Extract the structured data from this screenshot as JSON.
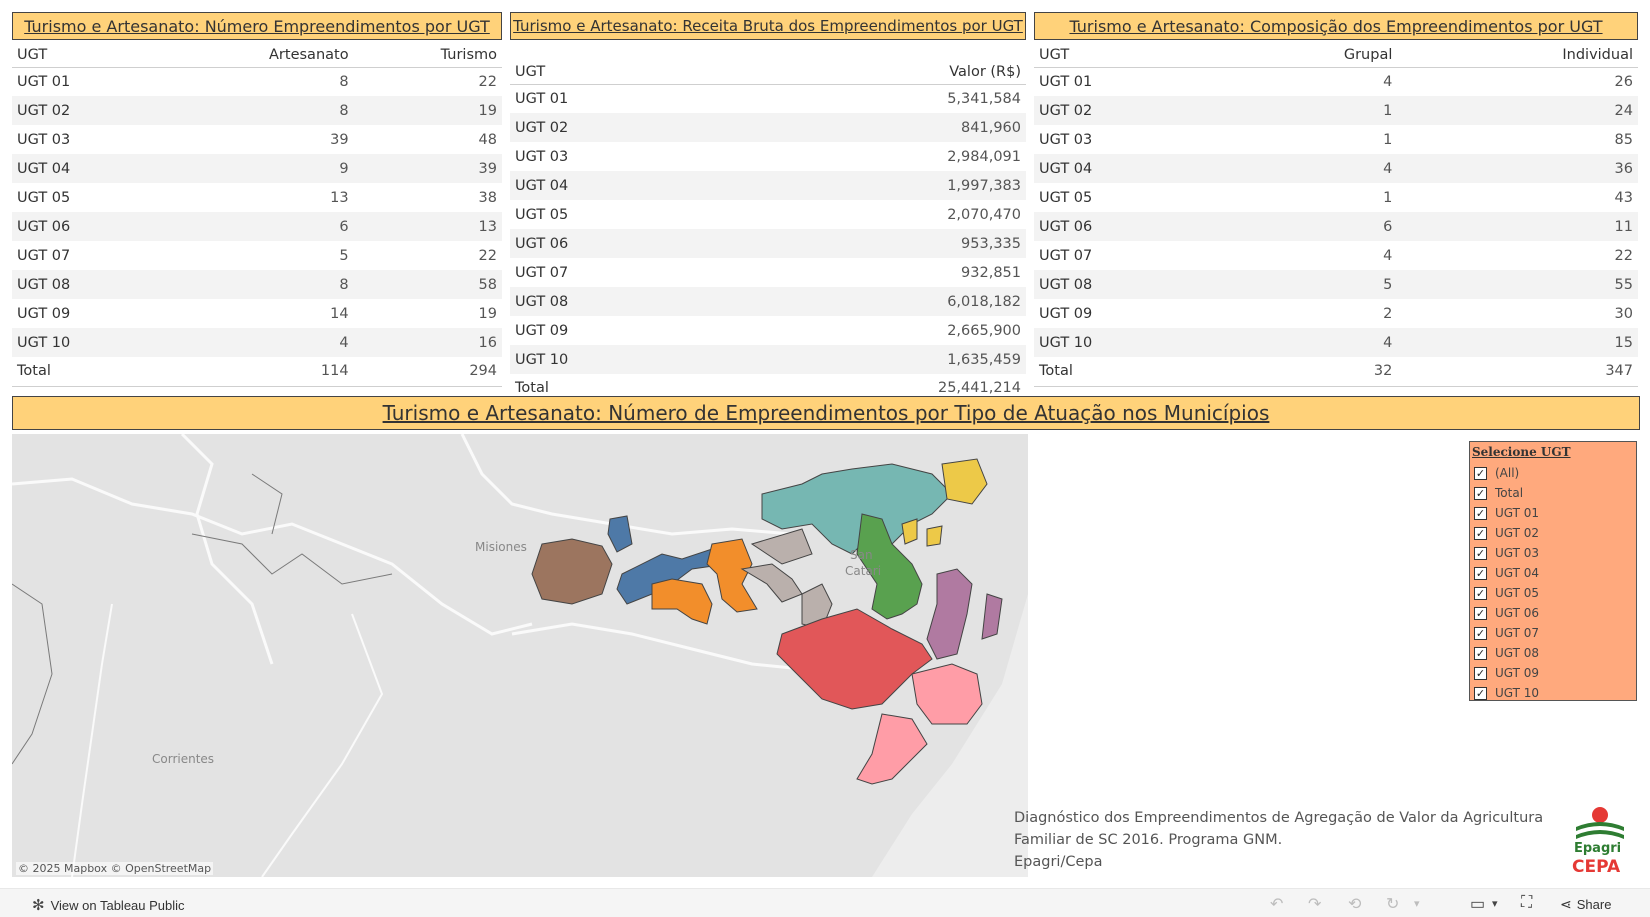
{
  "panels": {
    "numero": {
      "title": "Turismo e Artesanato: Número Empreendimentos por UGT",
      "headers": [
        "UGT",
        "Artesanato",
        "Turismo"
      ],
      "rows": [
        [
          "UGT 01",
          "8",
          "22"
        ],
        [
          "UGT 02",
          "8",
          "19"
        ],
        [
          "UGT 03",
          "39",
          "48"
        ],
        [
          "UGT 04",
          "9",
          "39"
        ],
        [
          "UGT 05",
          "13",
          "38"
        ],
        [
          "UGT 06",
          "6",
          "13"
        ],
        [
          "UGT 07",
          "5",
          "22"
        ],
        [
          "UGT 08",
          "8",
          "58"
        ],
        [
          "UGT 09",
          "14",
          "19"
        ],
        [
          "UGT 10",
          "4",
          "16"
        ]
      ],
      "total": [
        "Total",
        "114",
        "294"
      ]
    },
    "receita": {
      "title": "Turismo e Artesanato: Receita Bruta dos Empreendimentos por UGT",
      "headers": [
        "UGT",
        "Valor (R$)"
      ],
      "rows": [
        [
          "UGT 01",
          "5,341,584"
        ],
        [
          "UGT 02",
          "841,960"
        ],
        [
          "UGT 03",
          "2,984,091"
        ],
        [
          "UGT 04",
          "1,997,383"
        ],
        [
          "UGT 05",
          "2,070,470"
        ],
        [
          "UGT 06",
          "953,335"
        ],
        [
          "UGT 07",
          "932,851"
        ],
        [
          "UGT 08",
          "6,018,182"
        ],
        [
          "UGT 09",
          "2,665,900"
        ],
        [
          "UGT 10",
          "1,635,459"
        ]
      ],
      "total": [
        "Total",
        "25,441,214"
      ]
    },
    "composicao": {
      "title": "Turismo e Artesanato: Composição dos Empreendimentos por UGT",
      "headers": [
        "UGT",
        "Grupal",
        "Individual"
      ],
      "rows": [
        [
          "UGT 01",
          "4",
          "26"
        ],
        [
          "UGT 02",
          "1",
          "24"
        ],
        [
          "UGT 03",
          "1",
          "85"
        ],
        [
          "UGT 04",
          "4",
          "36"
        ],
        [
          "UGT 05",
          "1",
          "43"
        ],
        [
          "UGT 06",
          "6",
          "11"
        ],
        [
          "UGT 07",
          "4",
          "22"
        ],
        [
          "UGT 08",
          "5",
          "55"
        ],
        [
          "UGT 09",
          "2",
          "30"
        ],
        [
          "UGT 10",
          "4",
          "15"
        ]
      ],
      "total": [
        "Total",
        "32",
        "347"
      ]
    }
  },
  "map": {
    "title": "Turismo e Artesanato: Número de Empreendimentos por Tipo de Atuação nos Municípios",
    "labels": {
      "misiones": "Misiones",
      "corrientes": "Corrientes",
      "santa_catarina_1": "San",
      "santa_catarina_2": "Catari"
    },
    "attribution": "© 2025 Mapbox  © OpenStreetMap",
    "region_colors": {
      "ugt01": "#4e79a7",
      "ugt02": "#9c755f",
      "ugt03": "#f28e2b",
      "ugt04": "#bab0ac",
      "ugt05": "#76b7b2",
      "ugt06": "#edc948",
      "ugt07": "#59a14f",
      "ugt08": "#b07aa1",
      "ugt09": "#e15759",
      "ugt10": "#ff9da7"
    }
  },
  "filter": {
    "title": "Selecione  UGT",
    "items": [
      "(All)",
      "Total",
      "UGT 01",
      "UGT 02",
      "UGT 03",
      "UGT 04",
      "UGT 05",
      "UGT 06",
      "UGT 07",
      "UGT 08",
      "UGT 09",
      "UGT 10"
    ],
    "check_mark": "✓"
  },
  "source": {
    "line1": "Diagnóstico dos Empreendimentos de Agregação de Valor da Agricultura",
    "line2": "Familiar de SC 2016. Programa GNM.",
    "line3": "Epagri/Cepa"
  },
  "logo": {
    "line1": "Epagri",
    "line2": "CEPA"
  },
  "footer": {
    "view_label": "View on Tableau Public",
    "share_label": "Share"
  }
}
